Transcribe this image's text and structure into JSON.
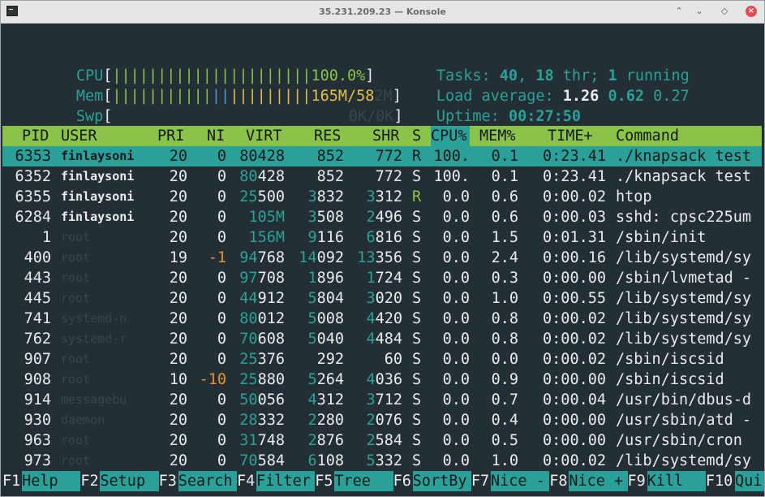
{
  "window": {
    "title": "35.231.209.23 — Konsole",
    "buttons": {
      "minimize": "⌃",
      "maximize": "⌄",
      "restore": "◇",
      "close": "×"
    }
  },
  "meters": {
    "cpu": {
      "label": "CPU",
      "bar": "||||||||||||||||||||||",
      "value": "100.0%",
      "fill_percent": 100.0
    },
    "mem": {
      "label": "Mem",
      "bar_used": "|||||||||||",
      "bar_buffer": "||",
      "bar_cache": "|||||||||",
      "value": "165M/58",
      "faded_tail": "2M"
    },
    "swp": {
      "label": "Swp",
      "value": "0K/0K"
    }
  },
  "info": {
    "tasks_label": "Tasks:",
    "tasks": "40",
    "thr": "18",
    "thr_label": "thr;",
    "running": "1",
    "running_label": "running",
    "load_label": "Load average:",
    "load1": "1.26",
    "load5": "0.62",
    "load15": "0.27",
    "uptime_label": "Uptime:",
    "uptime": "00:27:50"
  },
  "columns": [
    "PID",
    "USER",
    "PRI",
    "NI",
    "VIRT",
    "RES",
    "SHR",
    "S",
    "CPU%",
    "MEM%",
    "TIME+",
    "Command"
  ],
  "processes": [
    {
      "pid": "6353",
      "user": "finlaysoni",
      "pri": "20",
      "ni": "0",
      "virt": "80428",
      "res": "852",
      "shr": "772",
      "s": "R",
      "cpu": "100.",
      "mem": "0.1",
      "time": "0:23.41",
      "cmd": "./knapsack test",
      "selected": true
    },
    {
      "pid": "6352",
      "user": "finlaysoni",
      "pri": "20",
      "ni": "0",
      "virt": "80428",
      "res": "852",
      "shr": "772",
      "s": "S",
      "cpu": "100.",
      "mem": "0.1",
      "time": "0:23.41",
      "cmd": "./knapsack test"
    },
    {
      "pid": "6355",
      "user": "finlaysoni",
      "pri": "20",
      "ni": "0",
      "virt": "25500",
      "res": "3832",
      "shr": "3312",
      "s": "R",
      "cpu": "0.0",
      "mem": "0.6",
      "time": "0:00.02",
      "cmd": "htop"
    },
    {
      "pid": "6284",
      "user": "finlaysoni",
      "pri": "20",
      "ni": "0",
      "virt": "105M",
      "res": "3508",
      "shr": "2496",
      "s": "S",
      "cpu": "0.0",
      "mem": "0.6",
      "time": "0:00.03",
      "cmd": "sshd: cpsc225um"
    },
    {
      "pid": "1",
      "user": "root",
      "pri": "20",
      "ni": "0",
      "virt": "156M",
      "res": "9116",
      "shr": "6816",
      "s": "S",
      "cpu": "0.0",
      "mem": "1.5",
      "time": "0:01.31",
      "cmd": "/sbin/init"
    },
    {
      "pid": "400",
      "user": "root",
      "pri": "19",
      "ni": "-1",
      "virt": "94768",
      "res": "14092",
      "shr": "13356",
      "s": "S",
      "cpu": "0.0",
      "mem": "2.4",
      "time": "0:00.16",
      "cmd": "/lib/systemd/sy"
    },
    {
      "pid": "443",
      "user": "root",
      "pri": "20",
      "ni": "0",
      "virt": "97708",
      "res": "1896",
      "shr": "1724",
      "s": "S",
      "cpu": "0.0",
      "mem": "0.3",
      "time": "0:00.00",
      "cmd": "/sbin/lvmetad -"
    },
    {
      "pid": "445",
      "user": "root",
      "pri": "20",
      "ni": "0",
      "virt": "44912",
      "res": "5804",
      "shr": "3020",
      "s": "S",
      "cpu": "0.0",
      "mem": "1.0",
      "time": "0:00.55",
      "cmd": "/lib/systemd/sy"
    },
    {
      "pid": "741",
      "user": "systemd-n",
      "pri": "20",
      "ni": "0",
      "virt": "80012",
      "res": "5008",
      "shr": "4420",
      "s": "S",
      "cpu": "0.0",
      "mem": "0.8",
      "time": "0:00.02",
      "cmd": "/lib/systemd/sy"
    },
    {
      "pid": "762",
      "user": "systemd-r",
      "pri": "20",
      "ni": "0",
      "virt": "70608",
      "res": "5040",
      "shr": "4484",
      "s": "S",
      "cpu": "0.0",
      "mem": "0.8",
      "time": "0:00.02",
      "cmd": "/lib/systemd/sy"
    },
    {
      "pid": "907",
      "user": "root",
      "pri": "20",
      "ni": "0",
      "virt": "25376",
      "res": "292",
      "shr": "60",
      "s": "S",
      "cpu": "0.0",
      "mem": "0.0",
      "time": "0:00.02",
      "cmd": "/sbin/iscsid"
    },
    {
      "pid": "908",
      "user": "root",
      "pri": "10",
      "ni": "-10",
      "virt": "25880",
      "res": "5264",
      "shr": "4036",
      "s": "S",
      "cpu": "0.0",
      "mem": "0.9",
      "time": "0:00.00",
      "cmd": "/sbin/iscsid"
    },
    {
      "pid": "914",
      "user": "messagebu",
      "pri": "20",
      "ni": "0",
      "virt": "50056",
      "res": "4312",
      "shr": "3712",
      "s": "S",
      "cpu": "0.0",
      "mem": "0.7",
      "time": "0:00.04",
      "cmd": "/usr/bin/dbus-d"
    },
    {
      "pid": "930",
      "user": "daemon",
      "pri": "20",
      "ni": "0",
      "virt": "28332",
      "res": "2280",
      "shr": "2076",
      "s": "S",
      "cpu": "0.0",
      "mem": "0.4",
      "time": "0:00.00",
      "cmd": "/usr/sbin/atd -"
    },
    {
      "pid": "963",
      "user": "root",
      "pri": "20",
      "ni": "0",
      "virt": "31748",
      "res": "2876",
      "shr": "2584",
      "s": "S",
      "cpu": "0.0",
      "mem": "0.5",
      "time": "0:00.00",
      "cmd": "/usr/sbin/cron"
    },
    {
      "pid": "973",
      "user": "root",
      "pri": "20",
      "ni": "0",
      "virt": "70584",
      "res": "6108",
      "shr": "5332",
      "s": "S",
      "cpu": "0.0",
      "mem": "1.0",
      "time": "0:00.02",
      "cmd": "/lib/systemd/sy"
    }
  ],
  "function_keys": [
    {
      "key": "F1",
      "label": "Help  "
    },
    {
      "key": "F2",
      "label": "Setup "
    },
    {
      "key": "F3",
      "label": "Search"
    },
    {
      "key": "F4",
      "label": "Filter"
    },
    {
      "key": "F5",
      "label": "Tree  "
    },
    {
      "key": "F6",
      "label": "SortBy"
    },
    {
      "key": "F7",
      "label": "Nice -"
    },
    {
      "key": "F8",
      "label": "Nice +"
    },
    {
      "key": "F9",
      "label": "Kill  "
    },
    {
      "key": "F10",
      "label": "Qui"
    }
  ],
  "colors": {
    "background": "#232f34",
    "teal": "#2aa198",
    "green_header": "#8bc34a",
    "yellow_mem": "#e3c04a",
    "blue_mem": "#3b9ed8",
    "orange_nice": "#e8922f",
    "dim_user": "#3a464b"
  }
}
